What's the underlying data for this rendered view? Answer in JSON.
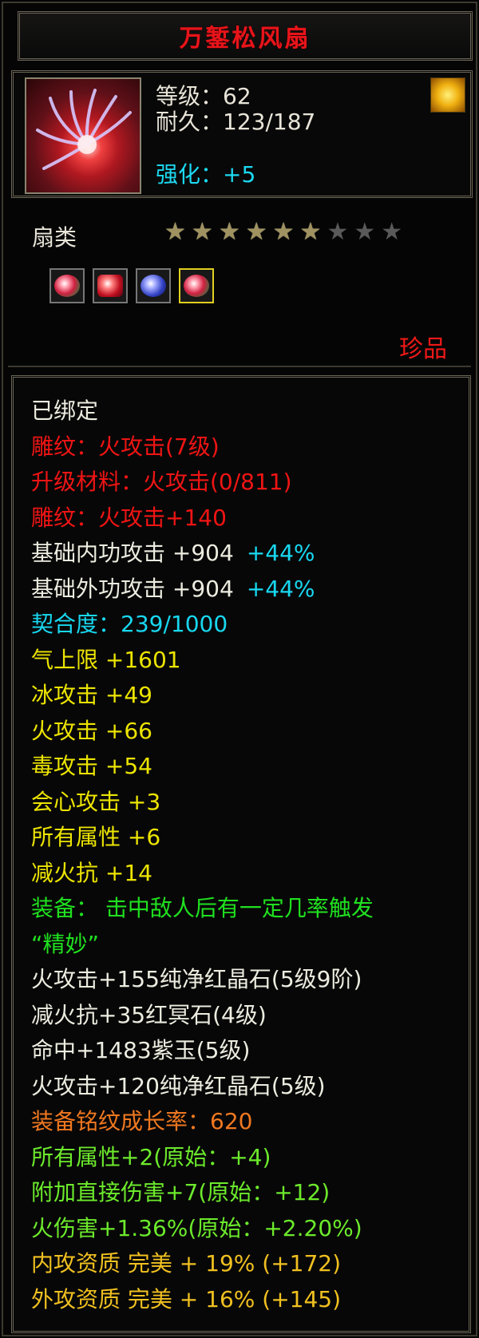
{
  "item": {
    "name": "万錾松风扇",
    "level_line": "等级：62",
    "durability_line": "耐久：123/187",
    "enhance_line": "强化：+5",
    "type": "扇类",
    "rarity": "珍品",
    "icon": "fan-item-icon",
    "emblem": "fire-emblem-icon"
  },
  "stars": {
    "filled": 6,
    "total": 9
  },
  "gems": [
    {
      "icon": "green-red-gem-icon",
      "selected": false
    },
    {
      "icon": "red-gem-icon",
      "selected": false
    },
    {
      "icon": "blue-gem-icon",
      "selected": false
    },
    {
      "icon": "green-red-gem-icon",
      "selected": true
    }
  ],
  "colors": {
    "white": "#ecece0",
    "red": "#f01414",
    "cyan": "#18d8f0",
    "yellow": "#ece400",
    "green": "#20e020",
    "orange": "#f07820",
    "lime": "#6cea2c",
    "gold": "#f0c020"
  },
  "properties": [
    {
      "text": "已绑定",
      "color": "white"
    },
    {
      "text": "雕纹：火攻击(7级)",
      "color": "red"
    },
    {
      "text": "升级材料：火攻击(0/811)",
      "color": "red"
    },
    {
      "text": "雕纹：火攻击+140",
      "color": "red"
    },
    {
      "text": "基础内功攻击 +904",
      "extra": "+44%",
      "color": "white",
      "extra_color": "cyan"
    },
    {
      "text": "基础外功攻击 +904",
      "extra": "+44%",
      "color": "white",
      "extra_color": "cyan"
    },
    {
      "text": "契合度：239/1000",
      "color": "cyan"
    },
    {
      "text": "气上限 +1601",
      "color": "yellow"
    },
    {
      "text": "冰攻击 +49",
      "color": "yellow"
    },
    {
      "text": "火攻击 +66",
      "color": "yellow"
    },
    {
      "text": "毒攻击 +54",
      "color": "yellow"
    },
    {
      "text": "会心攻击 +3",
      "color": "yellow"
    },
    {
      "text": "所有属性 +6",
      "color": "yellow"
    },
    {
      "text": "减火抗 +14",
      "color": "yellow"
    },
    {
      "text": "装备： 击中敌人后有一定几率触发",
      "color": "green"
    },
    {
      "text": "“精妙”",
      "color": "green"
    },
    {
      "text": "火攻击+155纯净红晶石(5级9阶)",
      "color": "white"
    },
    {
      "text": "减火抗+35红冥石(4级)",
      "color": "white"
    },
    {
      "text": "命中+1483紫玉(5级)",
      "color": "white"
    },
    {
      "text": "火攻击+120纯净红晶石(5级)",
      "color": "white"
    },
    {
      "text": "装备铭纹成长率：620",
      "color": "orange"
    },
    {
      "text": "所有属性+2(原始：+4)",
      "color": "lime"
    },
    {
      "text": "附加直接伤害+7(原始：+12)",
      "color": "lime"
    },
    {
      "text": "火伤害+1.36%(原始：+2.20%)",
      "color": "lime"
    },
    {
      "text": "内攻资质 完美 + 19% (+172)",
      "color": "gold"
    },
    {
      "text": "外攻资质 完美 + 16% (+145)",
      "color": "gold"
    }
  ]
}
